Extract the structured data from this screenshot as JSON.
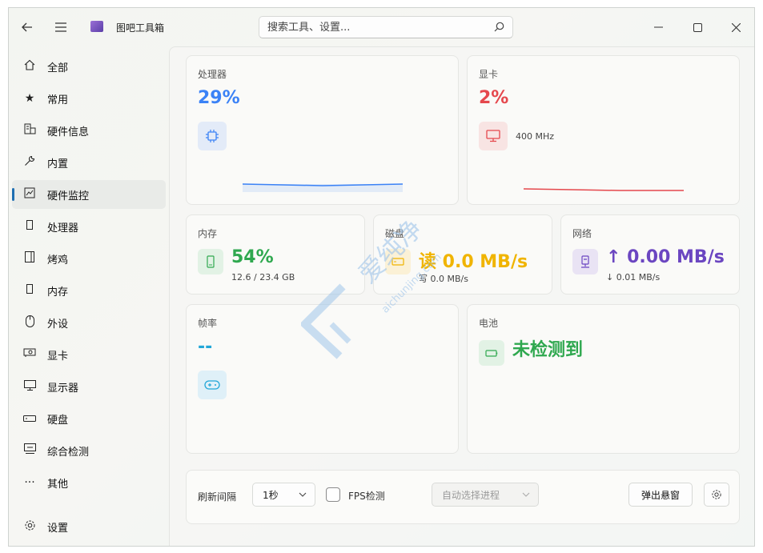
{
  "window": {
    "title": "图吧工具箱",
    "search_placeholder": "搜索工具、设置...",
    "icons": {
      "back": "back-arrow-icon",
      "menu": "hamburger-menu-icon",
      "search": "search-icon",
      "minimize": "minimize-icon",
      "maximize": "maximize-icon",
      "close": "close-icon"
    }
  },
  "sidebar": {
    "items": [
      {
        "label": "全部",
        "icon": "home-icon"
      },
      {
        "label": "常用",
        "icon": "star-icon"
      },
      {
        "label": "硬件信息",
        "icon": "hardware-info-icon"
      },
      {
        "label": "内置",
        "icon": "wrench-icon"
      },
      {
        "label": "硬件监控",
        "icon": "monitor-chart-icon",
        "active": true
      },
      {
        "label": "处理器",
        "icon": "cpu-icon"
      },
      {
        "label": "烤鸡",
        "icon": "stress-test-icon"
      },
      {
        "label": "内存",
        "icon": "memory-icon"
      },
      {
        "label": "外设",
        "icon": "mouse-icon"
      },
      {
        "label": "显卡",
        "icon": "gpu-icon"
      },
      {
        "label": "显示器",
        "icon": "display-icon"
      },
      {
        "label": "硬盘",
        "icon": "disk-icon"
      },
      {
        "label": "综合检测",
        "icon": "comprehensive-test-icon"
      },
      {
        "label": "其他",
        "icon": "more-icon"
      }
    ],
    "settings_label": "设置"
  },
  "cards": {
    "cpu": {
      "label": "处理器",
      "value": "29%",
      "color": "#3b82f6",
      "trend_color": "#3b82f6"
    },
    "gpu": {
      "label": "显卡",
      "value": "2%",
      "color": "#e5484d",
      "freq": "400 MHz",
      "trend_color": "#e5484d"
    },
    "memory": {
      "label": "内存",
      "value": "54%",
      "color": "#2fa84f",
      "detail": "12.6 / 23.4 GB"
    },
    "disk": {
      "label": "磁盘",
      "value": "读 0.0 MB/s",
      "color": "#f0b400",
      "detail": "写 0.0 MB/s"
    },
    "network": {
      "label": "网络",
      "value": "↑ 0.00 MB/s",
      "color": "#6b46c1",
      "detail": "↓ 0.01 MB/s"
    },
    "fps": {
      "label": "帧率",
      "value": "--",
      "color": "#22a7d8"
    },
    "battery": {
      "label": "电池",
      "value": "未检测到",
      "color": "#2fa84f"
    }
  },
  "toolbar": {
    "refresh_label": "刷新间隔",
    "refresh_value": "1秒",
    "fps_label": "FPS检测",
    "process_placeholder": "自动选择进程",
    "popup_button": "弹出悬窗"
  },
  "watermark": {
    "cn": "爱纯净",
    "en": "aichunjing.com"
  }
}
